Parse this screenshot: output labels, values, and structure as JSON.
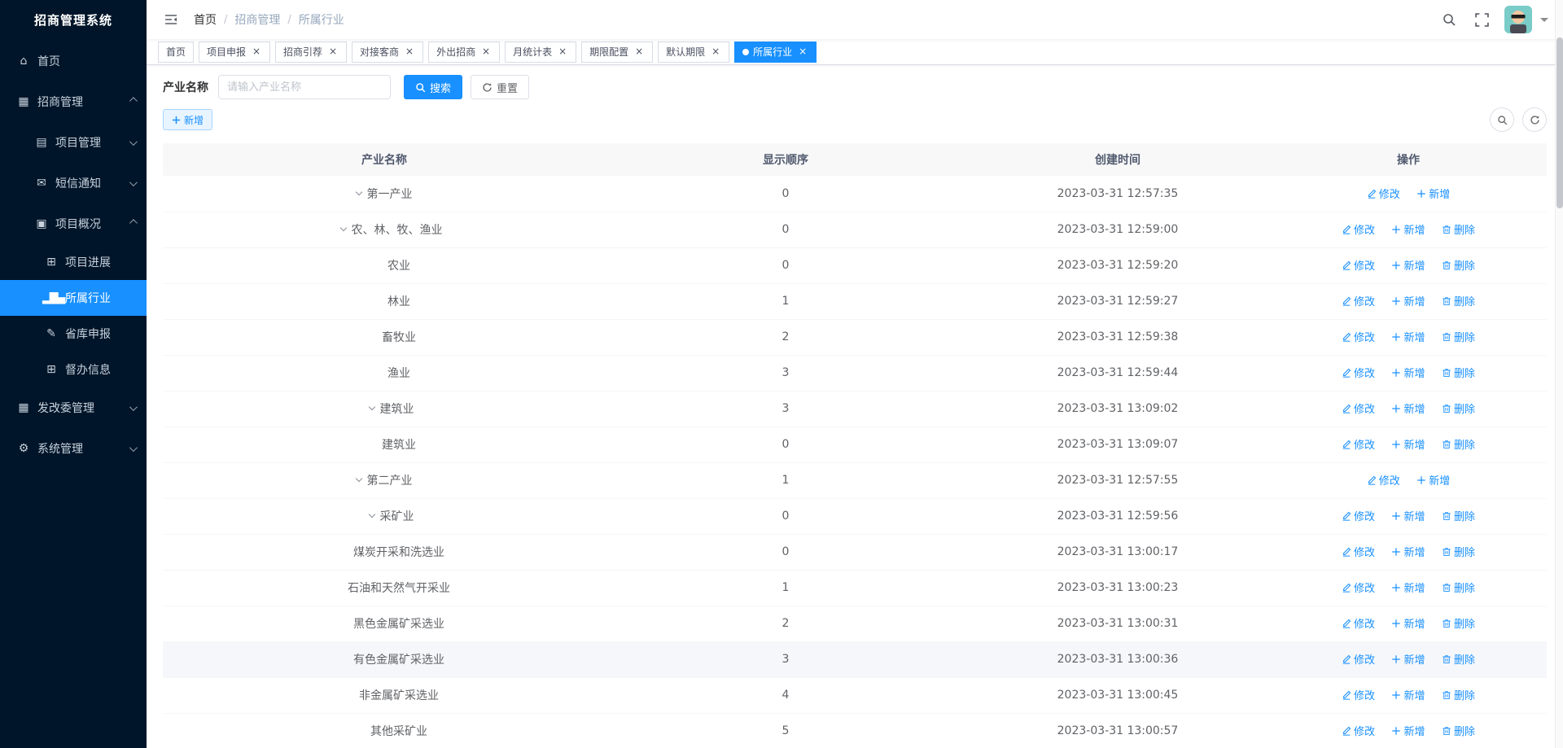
{
  "app": {
    "title": "招商管理系统"
  },
  "colors": {
    "primary": "#1890ff",
    "sidebar_bg": "#001529"
  },
  "sidebar": {
    "items": [
      {
        "id": "home",
        "icon": "home-icon",
        "label": "首页",
        "level": 0
      },
      {
        "id": "investment-management",
        "icon": "apps-icon",
        "label": "招商管理",
        "level": 0,
        "chevron": "up"
      },
      {
        "id": "project-management",
        "icon": "form-icon",
        "label": "项目管理",
        "level": 1,
        "chevron": "down"
      },
      {
        "id": "sms-notice",
        "icon": "message-icon",
        "label": "短信通知",
        "level": 1,
        "chevron": "down"
      },
      {
        "id": "project-overview",
        "icon": "doc-icon",
        "label": "项目概况",
        "level": 1,
        "chevron": "up"
      },
      {
        "id": "project-progress",
        "icon": "table-icon",
        "label": "项目进展",
        "level": 2
      },
      {
        "id": "industry",
        "icon": "chart-icon",
        "label": "所属行业",
        "level": 2,
        "active": true
      },
      {
        "id": "provincial-declare",
        "icon": "edit-icon",
        "label": "省库申报",
        "level": 2
      },
      {
        "id": "supervision-info",
        "icon": "table-icon",
        "label": "督办信息",
        "level": 2
      },
      {
        "id": "ndrc-management",
        "icon": "grid-icon",
        "label": "发改委管理",
        "level": 0,
        "chevron": "down"
      },
      {
        "id": "system-management",
        "icon": "gear-icon",
        "label": "系统管理",
        "level": 0,
        "chevron": "down"
      }
    ]
  },
  "navbar": {
    "breadcrumb": [
      "首页",
      "招商管理",
      "所属行业"
    ]
  },
  "tabs": [
    {
      "id": "home",
      "label": "首页",
      "closable": false
    },
    {
      "id": "project-declare",
      "label": "项目申报",
      "closable": true
    },
    {
      "id": "investment-referral",
      "label": "招商引荐",
      "closable": true
    },
    {
      "id": "merchant-docking",
      "label": "对接客商",
      "closable": true
    },
    {
      "id": "outbound-investment",
      "label": "外出招商",
      "closable": true
    },
    {
      "id": "monthly-stats",
      "label": "月统计表",
      "closable": true
    },
    {
      "id": "deadline-config",
      "label": "期限配置",
      "closable": true
    },
    {
      "id": "default-deadline",
      "label": "默认期限",
      "closable": true
    },
    {
      "id": "industry",
      "label": "所属行业",
      "closable": true,
      "active": true
    }
  ],
  "search": {
    "label": "产业名称",
    "placeholder": "请输入产业名称",
    "search_label": "搜索",
    "reset_label": "重置"
  },
  "toolbar": {
    "add_label": "新增"
  },
  "table": {
    "columns": [
      "产业名称",
      "显示顺序",
      "创建时间",
      "操作"
    ],
    "action_labels": {
      "edit": "修改",
      "add": "新增",
      "delete": "删除"
    },
    "rows": [
      {
        "name": "第一产业",
        "level": 0,
        "expanded": true,
        "order": "0",
        "created": "2023-03-31 12:57:35",
        "can_delete": false
      },
      {
        "name": "农、林、牧、渔业",
        "level": 1,
        "expanded": true,
        "order": "0",
        "created": "2023-03-31 12:59:00",
        "can_delete": true
      },
      {
        "name": "农业",
        "level": 2,
        "expanded": false,
        "order": "0",
        "created": "2023-03-31 12:59:20",
        "can_delete": true
      },
      {
        "name": "林业",
        "level": 2,
        "expanded": false,
        "order": "1",
        "created": "2023-03-31 12:59:27",
        "can_delete": true
      },
      {
        "name": "畜牧业",
        "level": 2,
        "expanded": false,
        "order": "2",
        "created": "2023-03-31 12:59:38",
        "can_delete": true
      },
      {
        "name": "渔业",
        "level": 2,
        "expanded": false,
        "order": "3",
        "created": "2023-03-31 12:59:44",
        "can_delete": true
      },
      {
        "name": "建筑业",
        "level": 1,
        "expanded": true,
        "order": "3",
        "created": "2023-03-31 13:09:02",
        "can_delete": true
      },
      {
        "name": "建筑业",
        "level": 2,
        "expanded": false,
        "order": "0",
        "created": "2023-03-31 13:09:07",
        "can_delete": true
      },
      {
        "name": "第二产业",
        "level": 0,
        "expanded": true,
        "order": "1",
        "created": "2023-03-31 12:57:55",
        "can_delete": false
      },
      {
        "name": "采矿业",
        "level": 1,
        "expanded": true,
        "order": "0",
        "created": "2023-03-31 12:59:56",
        "can_delete": true
      },
      {
        "name": "煤炭开采和洗选业",
        "level": 2,
        "expanded": false,
        "order": "0",
        "created": "2023-03-31 13:00:17",
        "can_delete": true
      },
      {
        "name": "石油和天然气开采业",
        "level": 2,
        "expanded": false,
        "order": "1",
        "created": "2023-03-31 13:00:23",
        "can_delete": true
      },
      {
        "name": "黑色金属矿采选业",
        "level": 2,
        "expanded": false,
        "order": "2",
        "created": "2023-03-31 13:00:31",
        "can_delete": true
      },
      {
        "name": "有色金属矿采选业",
        "level": 2,
        "expanded": false,
        "order": "3",
        "created": "2023-03-31 13:00:36",
        "can_delete": true,
        "highlighted": true
      },
      {
        "name": "非金属矿采选业",
        "level": 2,
        "expanded": false,
        "order": "4",
        "created": "2023-03-31 13:00:45",
        "can_delete": true
      },
      {
        "name": "其他采矿业",
        "level": 2,
        "expanded": false,
        "order": "5",
        "created": "2023-03-31 13:00:57",
        "can_delete": true
      }
    ]
  }
}
